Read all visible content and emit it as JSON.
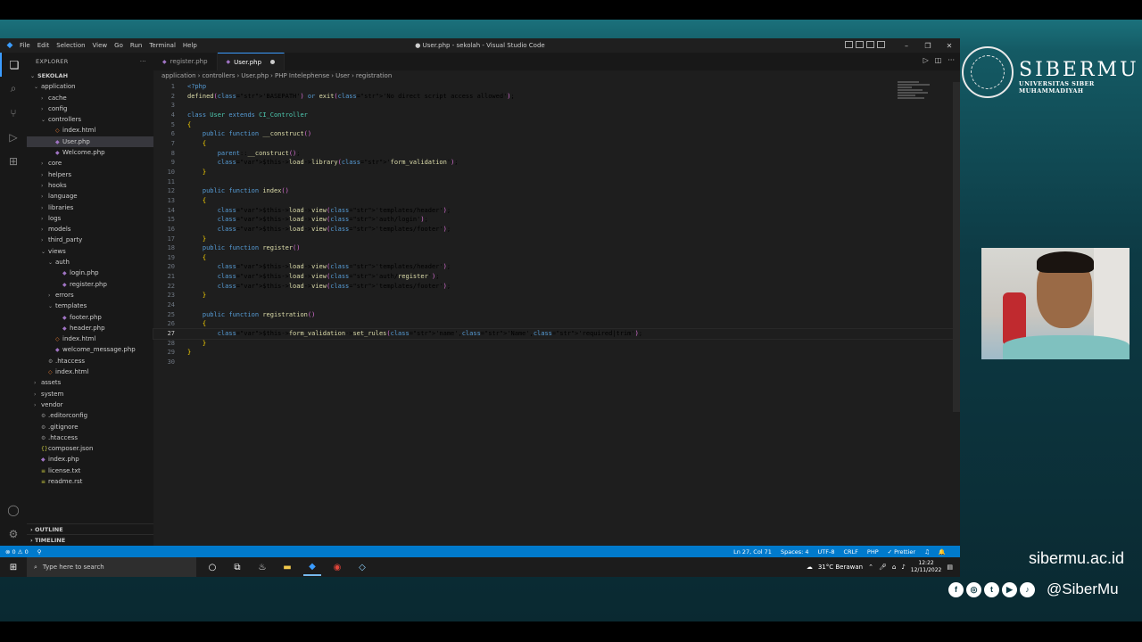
{
  "window": {
    "title": "● User.php - sekolah - Visual Studio Code",
    "menu": [
      "File",
      "Edit",
      "Selection",
      "View",
      "Go",
      "Run",
      "Terminal",
      "Help"
    ]
  },
  "explorer": {
    "header": "EXPLORER",
    "root": "SEKOLAH",
    "tree": [
      {
        "label": "application",
        "depth": 0,
        "type": "folder-open"
      },
      {
        "label": "cache",
        "depth": 1,
        "type": "folder"
      },
      {
        "label": "config",
        "depth": 1,
        "type": "folder"
      },
      {
        "label": "controllers",
        "depth": 1,
        "type": "folder-open"
      },
      {
        "label": "index.html",
        "depth": 2,
        "type": "html"
      },
      {
        "label": "User.php",
        "depth": 2,
        "type": "php",
        "selected": true
      },
      {
        "label": "Welcome.php",
        "depth": 2,
        "type": "php"
      },
      {
        "label": "core",
        "depth": 1,
        "type": "folder"
      },
      {
        "label": "helpers",
        "depth": 1,
        "type": "folder"
      },
      {
        "label": "hooks",
        "depth": 1,
        "type": "folder"
      },
      {
        "label": "language",
        "depth": 1,
        "type": "folder"
      },
      {
        "label": "libraries",
        "depth": 1,
        "type": "folder"
      },
      {
        "label": "logs",
        "depth": 1,
        "type": "folder"
      },
      {
        "label": "models",
        "depth": 1,
        "type": "folder"
      },
      {
        "label": "third_party",
        "depth": 1,
        "type": "folder"
      },
      {
        "label": "views",
        "depth": 1,
        "type": "folder-open"
      },
      {
        "label": "auth",
        "depth": 2,
        "type": "folder-open"
      },
      {
        "label": "login.php",
        "depth": 3,
        "type": "php"
      },
      {
        "label": "register.php",
        "depth": 3,
        "type": "php"
      },
      {
        "label": "errors",
        "depth": 2,
        "type": "folder"
      },
      {
        "label": "templates",
        "depth": 2,
        "type": "folder-open"
      },
      {
        "label": "footer.php",
        "depth": 3,
        "type": "php"
      },
      {
        "label": "header.php",
        "depth": 3,
        "type": "php"
      },
      {
        "label": "index.html",
        "depth": 2,
        "type": "html"
      },
      {
        "label": "welcome_message.php",
        "depth": 2,
        "type": "php"
      },
      {
        "label": ".htaccess",
        "depth": 1,
        "type": "gear"
      },
      {
        "label": "index.html",
        "depth": 1,
        "type": "html"
      },
      {
        "label": "assets",
        "depth": 0,
        "type": "folder"
      },
      {
        "label": "system",
        "depth": 0,
        "type": "folder"
      },
      {
        "label": "vendor",
        "depth": 0,
        "type": "folder"
      },
      {
        "label": ".editorconfig",
        "depth": 0,
        "type": "gear"
      },
      {
        "label": ".gitignore",
        "depth": 0,
        "type": "gear"
      },
      {
        "label": ".htaccess",
        "depth": 0,
        "type": "gear"
      },
      {
        "label": "composer.json",
        "depth": 0,
        "type": "json"
      },
      {
        "label": "index.php",
        "depth": 0,
        "type": "php"
      },
      {
        "label": "license.txt",
        "depth": 0,
        "type": "txt"
      },
      {
        "label": "readme.rst",
        "depth": 0,
        "type": "txt"
      }
    ],
    "outline": "OUTLINE",
    "timeline": "TIMELINE"
  },
  "tabs": [
    {
      "label": "register.php",
      "active": false
    },
    {
      "label": "User.php",
      "active": true
    }
  ],
  "breadcrumb": [
    "application",
    "›",
    "controllers",
    "›",
    "User.php",
    "›",
    "PHP Intelephense",
    "›",
    "User",
    "›",
    "registration"
  ],
  "code": [
    "<?php",
    "defined('BASEPATH') or exit('No direct script access allowed');",
    "",
    "class User extends CI_Controller",
    "{",
    "    public function __construct()",
    "    {",
    "        parent::__construct();",
    "        $this->load->library('form_validation');",
    "    }",
    "",
    "    public function index()",
    "    {",
    "        $this->load->view('templates/header');",
    "        $this->load->view('auth/login');",
    "        $this->load->view('templates/footer');",
    "    }",
    "    public function register()",
    "    {",
    "        $this->load->view('templates/header');",
    "        $this->load->view('auth/register');",
    "        $this->load->view('templates/footer');",
    "    }",
    "",
    "    public function registration()",
    "    {",
    "        $this->form_validation->set_rules('name','Name','required|trim');",
    "    }",
    "}",
    ""
  ],
  "current_line": 27,
  "status": {
    "left": [
      "⊗ 0 ⚠ 0",
      "⚲"
    ],
    "right": [
      "Ln 27, Col 71",
      "Spaces: 4",
      "UTF-8",
      "CRLF",
      "PHP",
      "✓ Prettier",
      "♫",
      "🔔"
    ]
  },
  "taskbar": {
    "search_placeholder": "Type here to search",
    "weather": "31°C  Berawan",
    "time": "12:22",
    "date": "12/11/2022"
  },
  "brand": {
    "name": "SIBERMU",
    "subtitle": "UNIVERSITAS SIBER MUHAMMADIYAH",
    "site": "sibermu.ac.id",
    "handle": "@SiberMu",
    "social": [
      "facebook-icon",
      "instagram-icon",
      "twitter-icon",
      "youtube-icon",
      "tiktok-icon"
    ]
  },
  "colors": {
    "accent": "#007acc",
    "php_icon": "#a074c4"
  }
}
